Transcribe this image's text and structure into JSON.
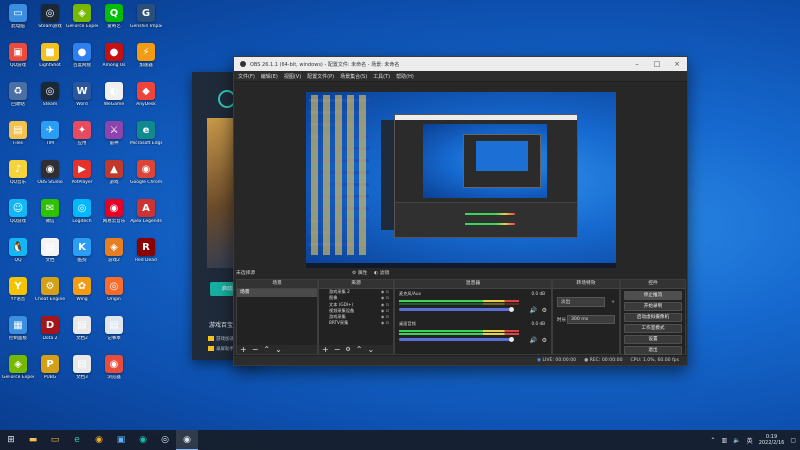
{
  "desktop": {
    "icons": [
      {
        "label": "此电脑",
        "glyph": "▭",
        "color": "#3b8fe0",
        "col": 0,
        "row": 0
      },
      {
        "label": "Steam游戏",
        "glyph": "◎",
        "color": "#1b2838",
        "col": 1,
        "row": 0
      },
      {
        "label": "GeForce Experience",
        "glyph": "◈",
        "color": "#76b900",
        "col": 2,
        "row": 0
      },
      {
        "label": "爱奇艺",
        "glyph": "Q",
        "color": "#00be06",
        "col": 3,
        "row": 0
      },
      {
        "label": "Genshin Impact",
        "glyph": "G",
        "color": "#2a4f7a",
        "col": 4,
        "row": 0
      },
      {
        "label": "QQ游戏",
        "glyph": "▣",
        "color": "#e94b3c",
        "col": 0,
        "row": 1
      },
      {
        "label": "LightShot",
        "glyph": "■",
        "color": "#f4c21c",
        "col": 1,
        "row": 1
      },
      {
        "label": "百度网盘",
        "glyph": "●",
        "color": "#2f80ed",
        "col": 2,
        "row": 1
      },
      {
        "label": "Among Us",
        "glyph": "●",
        "color": "#c51111",
        "col": 3,
        "row": 1
      },
      {
        "label": "加速器",
        "glyph": "⚡",
        "color": "#f39c12",
        "col": 4,
        "row": 1
      },
      {
        "label": "回收站",
        "glyph": "♻",
        "color": "#4a6fa5",
        "col": 0,
        "row": 2
      },
      {
        "label": "Steam",
        "glyph": "◎",
        "color": "#1b2838",
        "col": 1,
        "row": 2
      },
      {
        "label": "Word",
        "glyph": "W",
        "color": "#2b579a",
        "col": 2,
        "row": 2
      },
      {
        "label": "WeGame",
        "glyph": "◐",
        "color": "#f0f0f0",
        "col": 3,
        "row": 2
      },
      {
        "label": "AnyDesk",
        "glyph": "◆",
        "color": "#ef443b",
        "col": 4,
        "row": 2
      },
      {
        "label": "Files",
        "glyph": "▤",
        "color": "#f2c14e",
        "col": 0,
        "row": 3
      },
      {
        "label": "TIM",
        "glyph": "✈",
        "color": "#2a9df4",
        "col": 1,
        "row": 3
      },
      {
        "label": "应用",
        "glyph": "✦",
        "color": "#e84a5f",
        "col": 2,
        "row": 3
      },
      {
        "label": "雷神",
        "glyph": "⚔",
        "color": "#8e44ad",
        "col": 3,
        "row": 3
      },
      {
        "label": "Microsoft Edge",
        "glyph": "e",
        "color": "#0f8a8f",
        "col": 4,
        "row": 3
      },
      {
        "label": "QQ音乐",
        "glyph": "♪",
        "color": "#f7d33b",
        "col": 0,
        "row": 4
      },
      {
        "label": "OBS Studio",
        "glyph": "◉",
        "color": "#302e31",
        "col": 1,
        "row": 4
      },
      {
        "label": "PotPlayer",
        "glyph": "▶",
        "color": "#e5322d",
        "col": 2,
        "row": 4
      },
      {
        "label": "游戏",
        "glyph": "▲",
        "color": "#c0392b",
        "col": 3,
        "row": 4
      },
      {
        "label": "Google Chrome",
        "glyph": "◉",
        "color": "#db4437",
        "col": 4,
        "row": 4
      },
      {
        "label": "QQ游戏",
        "glyph": "☺",
        "color": "#12b7f5",
        "col": 0,
        "row": 5
      },
      {
        "label": "微信",
        "glyph": "✉",
        "color": "#2dc100",
        "col": 1,
        "row": 5
      },
      {
        "label": "Logitech",
        "glyph": "◎",
        "color": "#00b8fc",
        "col": 2,
        "row": 5
      },
      {
        "label": "网易云音乐",
        "glyph": "◉",
        "color": "#e60026",
        "col": 3,
        "row": 5
      },
      {
        "label": "Apex Legends",
        "glyph": "A",
        "color": "#cd3333",
        "col": 4,
        "row": 5
      },
      {
        "label": "QQ",
        "glyph": "🐧",
        "color": "#12b7f5",
        "col": 0,
        "row": 6
      },
      {
        "label": "文档",
        "glyph": "▤",
        "color": "#f4f4f4",
        "col": 1,
        "row": 6
      },
      {
        "label": "酷狗",
        "glyph": "K",
        "color": "#2a9df4",
        "col": 2,
        "row": 6
      },
      {
        "label": "游戏2",
        "glyph": "◈",
        "color": "#e67e22",
        "col": 3,
        "row": 6
      },
      {
        "label": "Red Dead",
        "glyph": "R",
        "color": "#8b0000",
        "col": 4,
        "row": 6
      },
      {
        "label": "YY语音",
        "glyph": "Y",
        "color": "#f5c400",
        "col": 0,
        "row": 7
      },
      {
        "label": "Cheat Engine",
        "glyph": "⚙",
        "color": "#d4a017",
        "col": 1,
        "row": 7
      },
      {
        "label": "Wing",
        "glyph": "✿",
        "color": "#f39c12",
        "col": 2,
        "row": 7
      },
      {
        "label": "Origin",
        "glyph": "◎",
        "color": "#f56c2d",
        "col": 3,
        "row": 7
      },
      {
        "label": "控制面板",
        "glyph": "▦",
        "color": "#3b8fe0",
        "col": 0,
        "row": 8
      },
      {
        "label": "Dota 2",
        "glyph": "D",
        "color": "#a4161a",
        "col": 1,
        "row": 8
      },
      {
        "label": "文档2",
        "glyph": "▤",
        "color": "#e8e8e8",
        "col": 2,
        "row": 8
      },
      {
        "label": "记事本",
        "glyph": "▤",
        "color": "#dfe6ee",
        "col": 3,
        "row": 8
      },
      {
        "label": "GeForce Experience",
        "glyph": "◈",
        "color": "#76b900",
        "col": 0,
        "row": 9
      },
      {
        "label": "PUBG",
        "glyph": "P",
        "color": "#d4a017",
        "col": 1,
        "row": 9
      },
      {
        "label": "文档3",
        "glyph": "▤",
        "color": "#e8e8e8",
        "col": 2,
        "row": 9
      },
      {
        "label": "浏览器",
        "glyph": "◉",
        "color": "#e74c3c",
        "col": 3,
        "row": 9
      }
    ]
  },
  "launcher": {
    "button": "启动游戏",
    "title": "游戏百宝箱",
    "rows": [
      "游戏加速",
      "录屏助手"
    ]
  },
  "obs": {
    "title": "OBS 26.1.1 (64-bit, windows) - 配置文件: 未命名 - 场景: 未命名",
    "menu": [
      "文件(F)",
      "编辑(E)",
      "视图(V)",
      "配置文件(P)",
      "场景集合(S)",
      "工具(T)",
      "帮助(H)"
    ],
    "top_labels": {
      "no_source": "未选择源",
      "props": "属性",
      "filters": "滤镜"
    },
    "docks": {
      "scenes": {
        "header": "场景",
        "items": [
          "场景"
        ]
      },
      "sources": {
        "header": "来源",
        "items": [
          "游戏采集 2",
          "图像",
          "文本 (GDI+)",
          "视频采集设备",
          "游戏采集",
          "BRTV采集"
        ]
      },
      "mixer": {
        "header": "混音器",
        "channels": [
          {
            "name": "麦克风/Aux",
            "db": "0.0 dB"
          },
          {
            "name": "桌面音频",
            "db": "0.0 dB"
          }
        ]
      },
      "transitions": {
        "header": "转场特效",
        "type": "淡出",
        "duration_label": "时长",
        "duration": "300 ms"
      },
      "controls": {
        "header": "控件",
        "buttons": [
          "停止推流",
          "开始录制",
          "启动虚拟摄像机",
          "工作室模式",
          "设置",
          "退出"
        ]
      }
    },
    "status": {
      "live": "LIVE: 00:00:00",
      "rec": "REC: 00:00:00",
      "cpu": "CPU: 1.0%, 60.00 fps"
    }
  },
  "taskbar": {
    "time": "0:19",
    "date": "2022/2/16"
  }
}
